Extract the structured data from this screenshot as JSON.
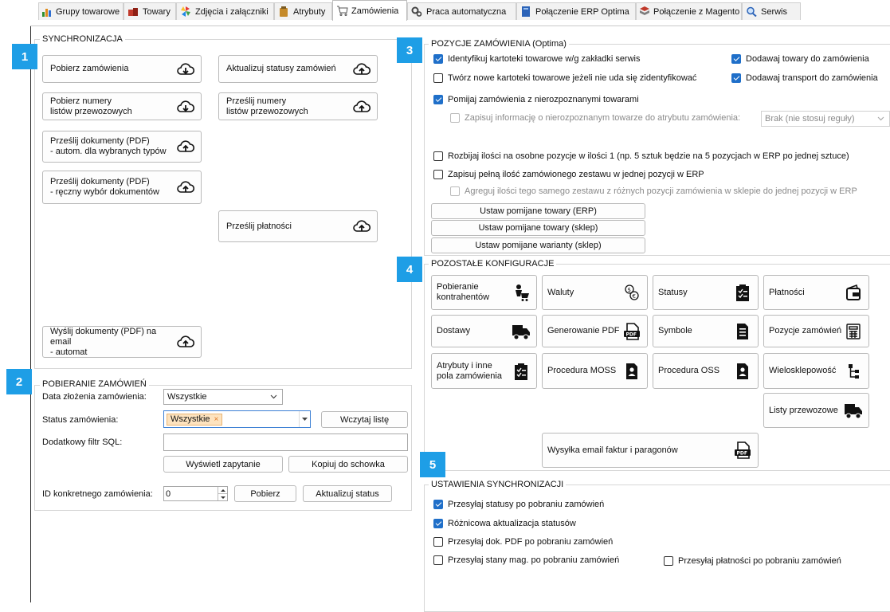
{
  "tabs": [
    {
      "label": "Grupy towarowe",
      "icon": "bar-chart-icon"
    },
    {
      "label": "Towary",
      "icon": "boxes-icon"
    },
    {
      "label": "Zdjęcia i załączniki",
      "icon": "pinwheel-icon"
    },
    {
      "label": "Atrybuty",
      "icon": "clipboard-icon"
    },
    {
      "label": "Zamówienia",
      "icon": "cart-icon"
    },
    {
      "label": "Praca automatyczna",
      "icon": "gears-icon"
    },
    {
      "label": "Połączenie ERP Optima",
      "icon": "book-icon"
    },
    {
      "label": "Połączenie z Magento",
      "icon": "magento-icon"
    },
    {
      "label": "Serwis",
      "icon": "magnifier-icon"
    }
  ],
  "active_tab": "Zamówienia",
  "badges": {
    "b1": "1",
    "b2": "2",
    "b3": "3",
    "b4": "4",
    "b5": "5"
  },
  "sync": {
    "title": "SYNCHRONIZACJA",
    "pobierz": "Pobierz zamówienia",
    "aktualizuj": "Aktualizuj statusy zamówień",
    "numery_a": "Pobierz numery",
    "numery_b": "listów przewozowych",
    "przeslij_num_a": "Prześlij numery",
    "przeslij_num_b": "listów przewozowych",
    "dok_auto_a": "Prześlij dokumenty (PDF)",
    "dok_auto_b": "- autom. dla wybranych typów",
    "dok_reczny_a": "Prześlij dokumenty (PDF)",
    "dok_reczny_b": "- ręczny wybór dokumentów",
    "platnosci": "Prześlij płatności",
    "email_a": "Wyślij dokumenty (PDF) na email",
    "email_b": "- automat"
  },
  "pobieranie": {
    "title": "POBIERANIE ZAMÓWIEŃ",
    "data_label": "Data złożenia zamówienia:",
    "data_value": "Wszystkie",
    "status_label": "Status zamówienia:",
    "status_tag": "Wszystkie",
    "wczytaj": "Wczytaj listę",
    "sql_label": "Dodatkowy filtr SQL:",
    "sql_value": "",
    "wyswietl": "Wyświetl zapytanie",
    "kopiuj": "Kopiuj do schowka",
    "id_label": "ID konkretnego zamówienia:",
    "id_value": "0",
    "pobierz": "Pobierz",
    "aktualizuj_status": "Aktualizuj status"
  },
  "pozycje": {
    "title": "POZYCJE ZAMÓWIENIA (Optima)",
    "c1": "Identyfikuj kartoteki towarowe w/g zakładki serwis",
    "c2": "Dodawaj towary do zamówienia",
    "c3": "Twórz nowe kartoteki towarowe jeżeli nie uda się zidentyfikować",
    "c4": "Dodawaj transport do zamówienia",
    "c5": "Pomijaj zamówienia z nierozpoznanymi towarami",
    "c6": "Zapisuj informację o nierozpoznanym towarze do atrybutu zamówienia:",
    "c6_select": "Brak (nie stosuj reguły)",
    "c7": "Rozbijaj ilości na osobne pozycje w ilości 1 (np. 5 sztuk będzie na 5 pozycjach  w ERP po jednej sztuce)",
    "c8": "Zapisuj pełną ilość zamówionego zestawu w jednej pozycji w ERP",
    "c9": "Agreguj ilości tego samego zestawu z różnych pozycji zamówienia w sklepie do jednej pozycji w ERP",
    "b1": "Ustaw pomijane towary (ERP)",
    "b2": "Ustaw pomijane towary (sklep)",
    "b3": "Ustaw pomijane warianty (sklep)"
  },
  "pozostale": {
    "title": "POZOSTAŁE KONFIGURACJE",
    "kontrahenci_a": "Pobieranie",
    "kontrahenci_b": "kontrahentów",
    "waluty": "Waluty",
    "statusy": "Statusy",
    "platnosci": "Płatności",
    "dostawy": "Dostawy",
    "pdf": "Generowanie PDF",
    "symbole": "Symbole",
    "pozycje": "Pozycje zamówień",
    "atrybuty_a": "Atrybuty i inne",
    "atrybuty_b": "pola zamówienia",
    "moss": "Procedura MOSS",
    "oss": "Procedura OSS",
    "wielosklep": "Wielosklepowość",
    "listy": "Listy przewozowe",
    "email": "Wysyłka email faktur i paragonów"
  },
  "ustawienia": {
    "title": "USTAWIENIA SYNCHRONIZACJI",
    "u1": "Przesyłaj statusy po pobraniu zamówień",
    "u2": "Różnicowa aktualizacja statusów",
    "u3": "Przesyłaj dok. PDF po pobraniu zamówień",
    "u4": "Przesyłaj stany mag. po pobraniu zamówień",
    "u5": "Przesyłaj płatności po pobraniu zamówień"
  },
  "colors": {
    "accent": "#1e9ee6",
    "checked": "#1f6fc9",
    "tag": "#fde3bf"
  }
}
